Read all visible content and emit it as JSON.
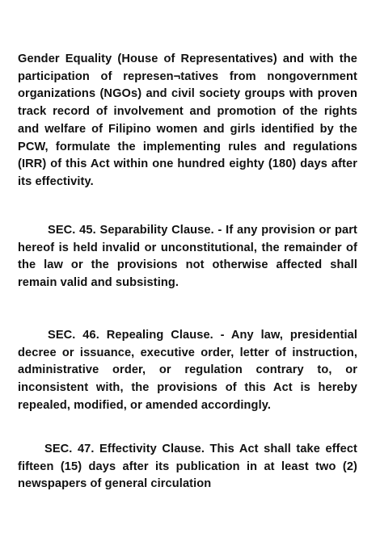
{
  "document": {
    "paragraphs": [
      {
        "text": "Gender Equality (House of Representatives) and with the participation of represen¬tatives from nongovernment organizations (NGOs) and civil society groups with proven track record of in­volvement and promotion of the rights and wel­fare of Filipino women and girls identified by the PCW,  formulate the implementing rules and reg­ulations (IRR) of this Act within one hundred eighty (180) days after its effectivity."
      },
      {
        "text": "SEC. 45. Separability Clause. - If any provi­sion or part hereof is held invalid or unconstitu­tional, the remainder of the law or the provisions not otherwise affected shall remain valid and subsisting."
      },
      {
        "text": "SEC. 46. Repealing Clause. - Any law, presi­dential decree or issuance, executive order, letter of instruction, administrative order, or regulation contrary to, or inconsistent with, the provisions of this Act is hereby repealed, modified, or amend­ed accordingly."
      },
      {
        "text": "SEC. 47. Effectivity Clause. This Act shall take effect fifteen (15) days after its publication in at least two (2) newspapers of general circulation"
      }
    ]
  }
}
